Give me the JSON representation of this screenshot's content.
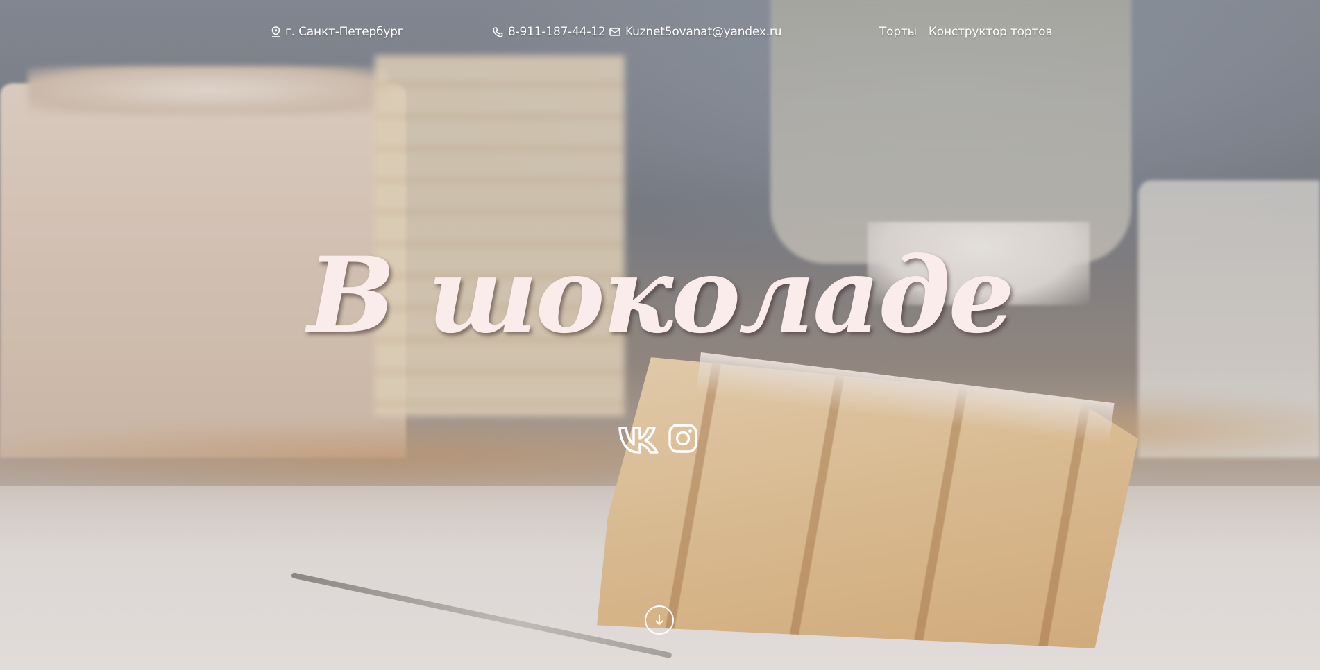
{
  "header": {
    "location": "г. Санкт-Петербург",
    "phone": "8-911-187-44-12",
    "email": "Kuznet5ovanat@yandex.ru",
    "nav": [
      {
        "label": "Торты"
      },
      {
        "label": "Конструктор тортов"
      }
    ],
    "icons": {
      "location": "map-pin-icon",
      "phone": "phone-icon",
      "email": "envelope-icon"
    }
  },
  "hero": {
    "title": "В шоколаде",
    "title_color": "#fbecec"
  },
  "socials": [
    {
      "icon": "vk-icon"
    },
    {
      "icon": "instagram-icon"
    }
  ],
  "scroll_icon": "arrow-down-icon"
}
